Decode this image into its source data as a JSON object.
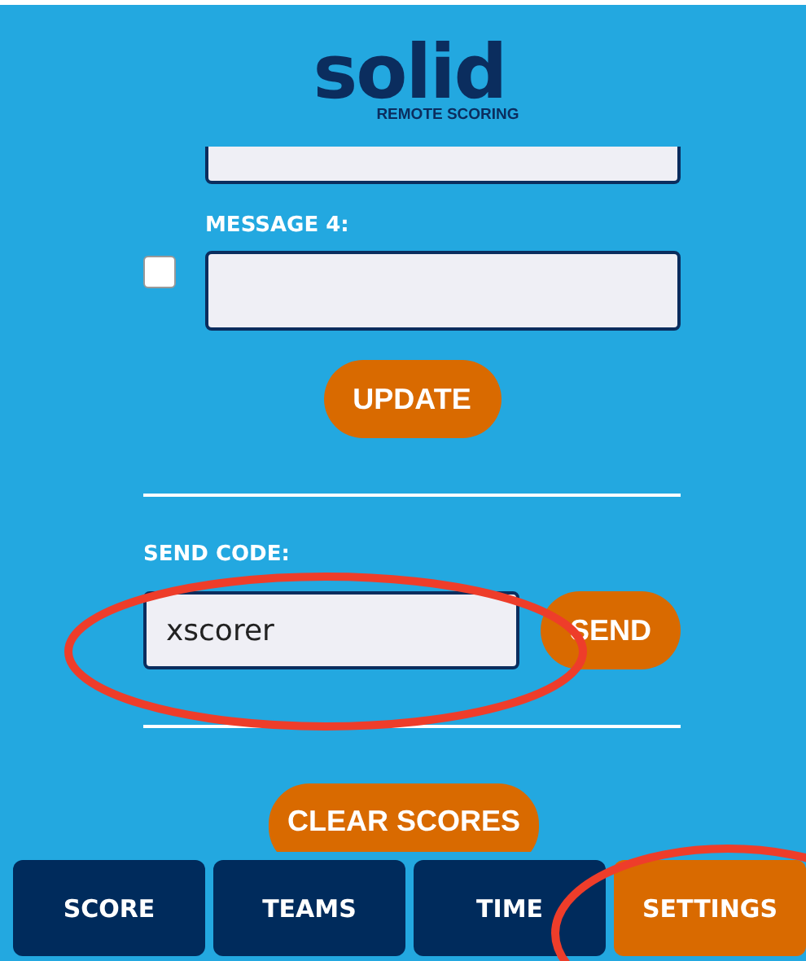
{
  "logo": {
    "name": "solid",
    "tagline": "REMOTE SCORING"
  },
  "messages": [
    {
      "kind": "partial"
    },
    {
      "kind": "full",
      "label": "MESSAGE 4:",
      "checked": false
    }
  ],
  "update_button": "UPDATE",
  "send_code": {
    "label": "SEND CODE:",
    "value": "xscorer",
    "button": "SEND"
  },
  "clear_button": "CLEAR SCORES",
  "tabs": [
    {
      "label": "SCORE",
      "selected": false
    },
    {
      "label": "TEAMS",
      "selected": false
    },
    {
      "label": "TIME",
      "selected": false
    },
    {
      "label": "SETTINGS",
      "selected": true
    }
  ],
  "annotations": [
    {
      "kind": "ellipse"
    },
    {
      "kind": "ellipse"
    }
  ]
}
